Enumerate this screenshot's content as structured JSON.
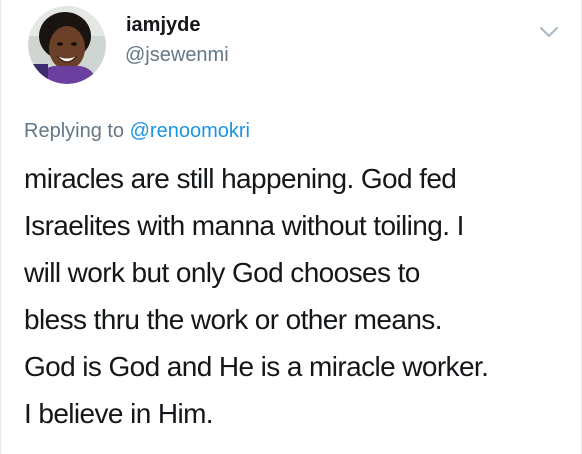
{
  "user": {
    "display_name": "iamjyde",
    "handle": "@jsewenmi"
  },
  "reply": {
    "prefix": "Replying to ",
    "mention": "@renoomokri"
  },
  "tweet": {
    "lines": [
      "miracles are still happening. God fed",
      "Israelites with manna without toiling. I",
      "will work but only God chooses to",
      "bless thru the work or other means.",
      "God is God and He is a miracle worker.",
      "I believe in Him."
    ]
  },
  "icons": {
    "menu": "chevron-down-icon"
  },
  "colors": {
    "text": "#14171a",
    "secondary": "#657786",
    "link": "#1b95e0"
  }
}
